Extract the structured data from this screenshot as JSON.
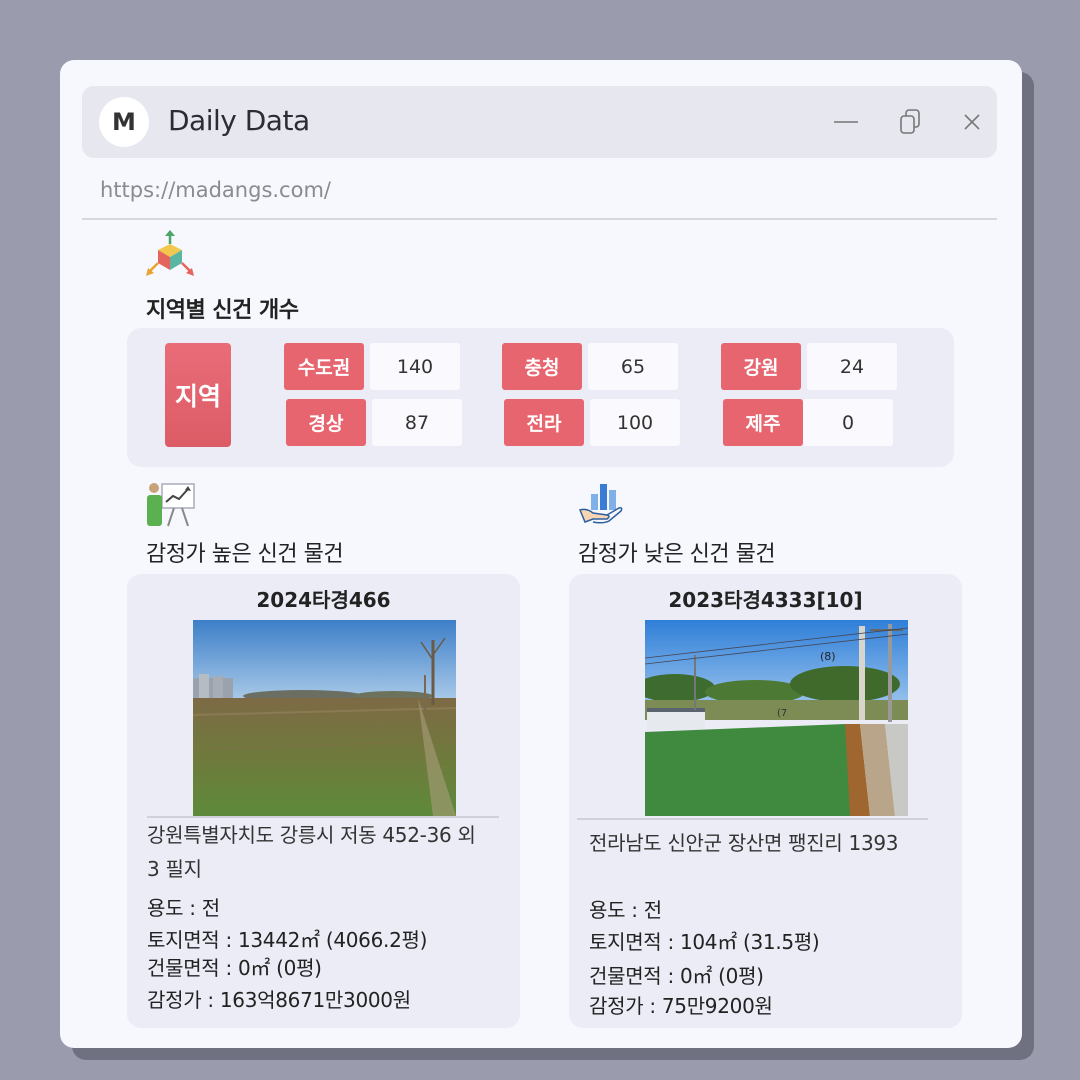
{
  "window": {
    "logo_letter": "M",
    "title": "Daily Data",
    "url": "https://madangs.com/"
  },
  "regions": {
    "title": "지역별 신건 개수",
    "main_label": "지역",
    "items": [
      {
        "name": "수도권",
        "count": "140"
      },
      {
        "name": "충청",
        "count": "65"
      },
      {
        "name": "강원",
        "count": "24"
      },
      {
        "name": "경상",
        "count": "87"
      },
      {
        "name": "전라",
        "count": "100"
      },
      {
        "name": "제주",
        "count": "0"
      }
    ]
  },
  "high": {
    "title": "감정가 높은 신건 물건",
    "case": "2024타경466",
    "address_line1": "강원특별자치도 강릉시 저동 452-36 외",
    "address_line2": "3 필지",
    "usage": "용도 : 전",
    "land_area": "토지면적 : 13442㎡ (4066.2평)",
    "building_area": "건물면적 : 0㎡ (0평)",
    "appraisal": "감정가 : 163억8671만3000원"
  },
  "low": {
    "title": "감정가 낮은 신건 물건",
    "case": "2023타경4333[10]",
    "address_line1": "전라남도 신안군 장산면 팽진리 1393",
    "usage": "용도 :  전",
    "land_area": "토지면적 : 104㎡ (31.5평)",
    "building_area": "건물면적 : 0㎡ (0평)",
    "appraisal": "감정가 : 75만9200원",
    "photo_label_8": "(8)",
    "photo_label_7": "(7"
  },
  "colors": {
    "accent_red": "#e6656f",
    "panel_bg": "#ebecf6",
    "window_bg": "#f7f8fd",
    "desktop_bg": "#9a9cad"
  }
}
